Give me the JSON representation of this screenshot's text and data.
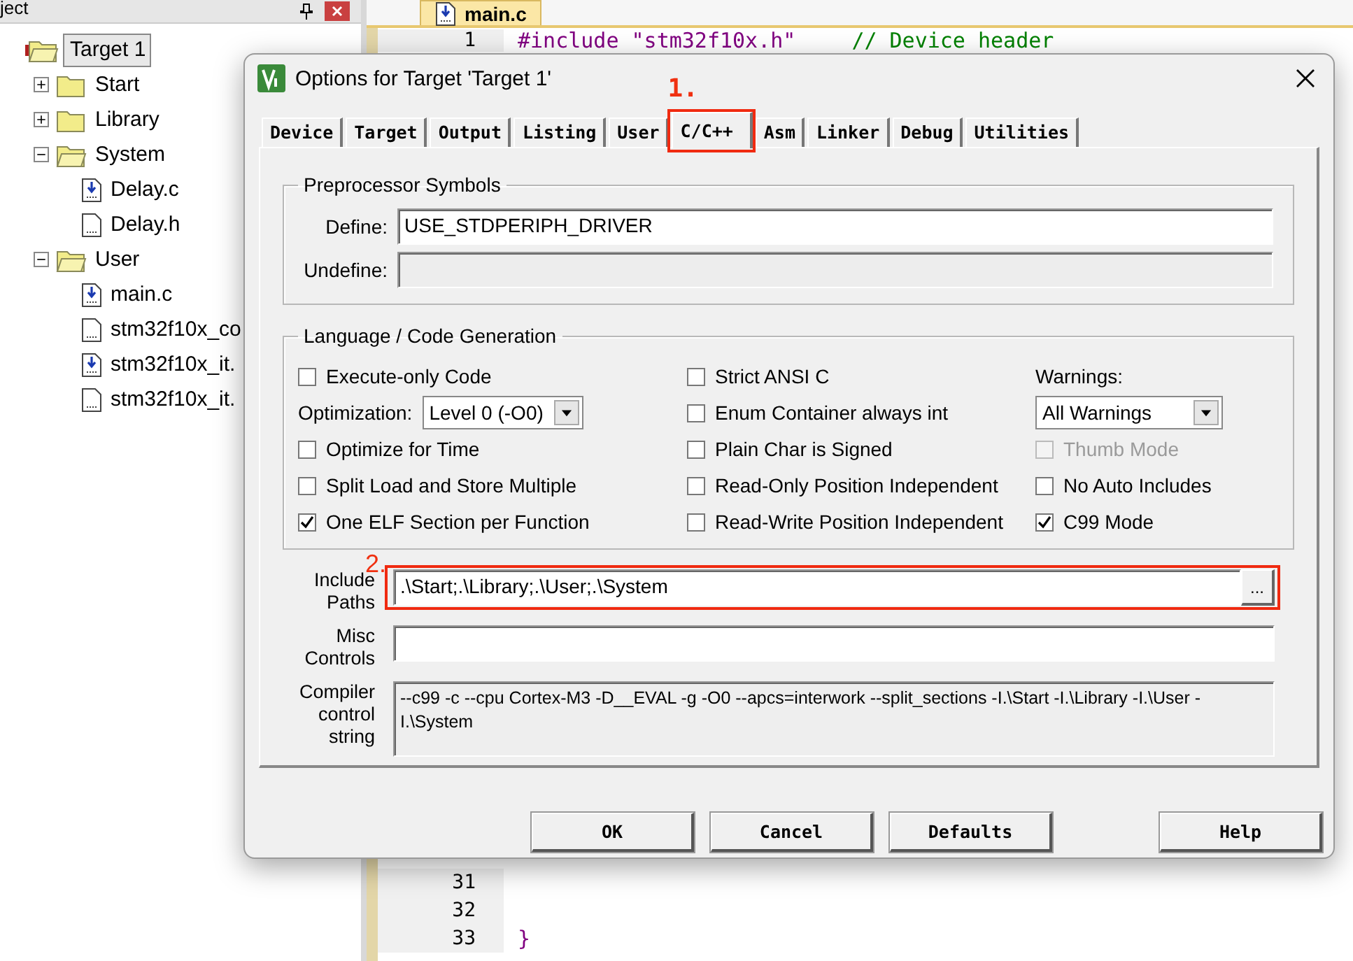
{
  "project_panel": {
    "title": "ject",
    "tree": [
      {
        "label": "Target 1",
        "kind": "target",
        "expanded": true,
        "selected": true,
        "children": [
          {
            "label": "Start",
            "kind": "folder",
            "expanded": false
          },
          {
            "label": "Library",
            "kind": "folder",
            "expanded": false
          },
          {
            "label": "System",
            "kind": "folder",
            "expanded": true,
            "children": [
              {
                "label": "Delay.c",
                "kind": "source"
              },
              {
                "label": "Delay.h",
                "kind": "header"
              }
            ]
          },
          {
            "label": "User",
            "kind": "folder",
            "expanded": true,
            "children": [
              {
                "label": "main.c",
                "kind": "source"
              },
              {
                "label": "stm32f10x_co",
                "kind": "header"
              },
              {
                "label": "stm32f10x_it.",
                "kind": "source"
              },
              {
                "label": "stm32f10x_it.",
                "kind": "header"
              }
            ]
          }
        ]
      }
    ]
  },
  "editor": {
    "tab": "main.c",
    "top_lines": [
      {
        "number": "1",
        "code": "#include \"stm32f10x.h\"",
        "comment": "// Device header"
      }
    ],
    "bottom_lines": [
      {
        "number": "31"
      },
      {
        "number": "32"
      },
      {
        "number": "33",
        "code": "}"
      }
    ]
  },
  "dialog": {
    "title": "Options for Target 'Target 1'",
    "tabs": [
      {
        "label": "Device",
        "selected": false
      },
      {
        "label": "Target",
        "selected": false
      },
      {
        "label": "Output",
        "selected": false
      },
      {
        "label": "Listing",
        "selected": false
      },
      {
        "label": "User",
        "selected": false
      },
      {
        "label": "C/C++",
        "selected": true,
        "annotation": "1."
      },
      {
        "label": "Asm",
        "selected": false
      },
      {
        "label": "Linker",
        "selected": false
      },
      {
        "label": "Debug",
        "selected": false
      },
      {
        "label": "Utilities",
        "selected": false
      }
    ],
    "preprocessor": {
      "title": "Preprocessor Symbols",
      "rows": [
        {
          "label": "Define:",
          "value": "USE_STDPERIPH_DRIVER",
          "disabled": false
        },
        {
          "label": "Undefine:",
          "value": "",
          "disabled": true
        }
      ]
    },
    "language": {
      "title": "Language / Code Generation",
      "columns": [
        [
          {
            "kind": "checkbox",
            "label": "Execute-only Code",
            "checked": false,
            "disabled": false
          },
          {
            "kind": "select",
            "label": "Optimization:",
            "value": "Level 0 (-O0)"
          },
          {
            "kind": "checkbox",
            "label": "Optimize for Time",
            "checked": false,
            "disabled": false
          },
          {
            "kind": "checkbox",
            "label": "Split Load and Store Multiple",
            "checked": false,
            "disabled": false
          },
          {
            "kind": "checkbox",
            "label": "One ELF Section per Function",
            "checked": true,
            "disabled": false
          }
        ],
        [
          {
            "kind": "checkbox",
            "label": "Strict ANSI C",
            "checked": false,
            "disabled": false
          },
          {
            "kind": "checkbox",
            "label": "Enum Container always int",
            "checked": false,
            "disabled": false
          },
          {
            "kind": "checkbox",
            "label": "Plain Char is Signed",
            "checked": false,
            "disabled": false
          },
          {
            "kind": "checkbox",
            "label": "Read-Only Position Independent",
            "checked": false,
            "disabled": false
          },
          {
            "kind": "checkbox",
            "label": "Read-Write Position Independent",
            "checked": false,
            "disabled": false
          }
        ],
        [
          {
            "kind": "label",
            "label": "Warnings:"
          },
          {
            "kind": "select",
            "value": "All Warnings"
          },
          {
            "kind": "checkbox",
            "label": "Thumb Mode",
            "checked": false,
            "disabled": true
          },
          {
            "kind": "checkbox",
            "label": "No Auto Includes",
            "checked": false,
            "disabled": false
          },
          {
            "kind": "checkbox",
            "label": "C99 Mode",
            "checked": true,
            "disabled": false
          }
        ]
      ]
    },
    "include_paths": {
      "label": "Include Paths",
      "value": ".\\Start;.\\Library;.\\User;.\\System",
      "button": "...",
      "annotation": "2."
    },
    "misc_controls": {
      "label": "Misc Controls"
    },
    "compiler_string": {
      "label": "Compiler control string",
      "value": "--c99 -c --cpu Cortex-M3 -D__EVAL -g -O0 --apcs=interwork --split_sections -I.\\Start -I.\\Library -I.\\User -I.\\System"
    },
    "buttons": [
      {
        "label": "OK",
        "kind": "normal"
      },
      {
        "label": "Cancel",
        "kind": "normal"
      },
      {
        "label": "Defaults",
        "kind": "normal"
      },
      {
        "label": "Help",
        "kind": "right"
      }
    ]
  }
}
